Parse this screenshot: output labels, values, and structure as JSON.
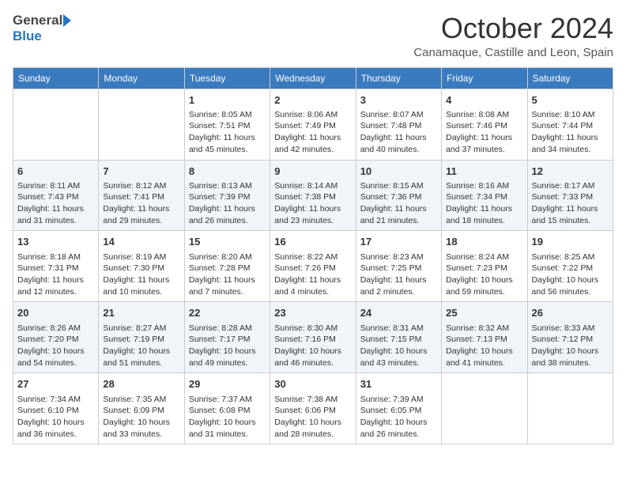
{
  "logo": {
    "line1": "General",
    "line2": "Blue"
  },
  "header": {
    "month": "October 2024",
    "location": "Canamaque, Castille and Leon, Spain"
  },
  "days_of_week": [
    "Sunday",
    "Monday",
    "Tuesday",
    "Wednesday",
    "Thursday",
    "Friday",
    "Saturday"
  ],
  "weeks": [
    [
      {
        "day": "",
        "data": ""
      },
      {
        "day": "",
        "data": ""
      },
      {
        "day": "1",
        "data": "Sunrise: 8:05 AM\nSunset: 7:51 PM\nDaylight: 11 hours and 45 minutes."
      },
      {
        "day": "2",
        "data": "Sunrise: 8:06 AM\nSunset: 7:49 PM\nDaylight: 11 hours and 42 minutes."
      },
      {
        "day": "3",
        "data": "Sunrise: 8:07 AM\nSunset: 7:48 PM\nDaylight: 11 hours and 40 minutes."
      },
      {
        "day": "4",
        "data": "Sunrise: 8:08 AM\nSunset: 7:46 PM\nDaylight: 11 hours and 37 minutes."
      },
      {
        "day": "5",
        "data": "Sunrise: 8:10 AM\nSunset: 7:44 PM\nDaylight: 11 hours and 34 minutes."
      }
    ],
    [
      {
        "day": "6",
        "data": "Sunrise: 8:11 AM\nSunset: 7:43 PM\nDaylight: 11 hours and 31 minutes."
      },
      {
        "day": "7",
        "data": "Sunrise: 8:12 AM\nSunset: 7:41 PM\nDaylight: 11 hours and 29 minutes."
      },
      {
        "day": "8",
        "data": "Sunrise: 8:13 AM\nSunset: 7:39 PM\nDaylight: 11 hours and 26 minutes."
      },
      {
        "day": "9",
        "data": "Sunrise: 8:14 AM\nSunset: 7:38 PM\nDaylight: 11 hours and 23 minutes."
      },
      {
        "day": "10",
        "data": "Sunrise: 8:15 AM\nSunset: 7:36 PM\nDaylight: 11 hours and 21 minutes."
      },
      {
        "day": "11",
        "data": "Sunrise: 8:16 AM\nSunset: 7:34 PM\nDaylight: 11 hours and 18 minutes."
      },
      {
        "day": "12",
        "data": "Sunrise: 8:17 AM\nSunset: 7:33 PM\nDaylight: 11 hours and 15 minutes."
      }
    ],
    [
      {
        "day": "13",
        "data": "Sunrise: 8:18 AM\nSunset: 7:31 PM\nDaylight: 11 hours and 12 minutes."
      },
      {
        "day": "14",
        "data": "Sunrise: 8:19 AM\nSunset: 7:30 PM\nDaylight: 11 hours and 10 minutes."
      },
      {
        "day": "15",
        "data": "Sunrise: 8:20 AM\nSunset: 7:28 PM\nDaylight: 11 hours and 7 minutes."
      },
      {
        "day": "16",
        "data": "Sunrise: 8:22 AM\nSunset: 7:26 PM\nDaylight: 11 hours and 4 minutes."
      },
      {
        "day": "17",
        "data": "Sunrise: 8:23 AM\nSunset: 7:25 PM\nDaylight: 11 hours and 2 minutes."
      },
      {
        "day": "18",
        "data": "Sunrise: 8:24 AM\nSunset: 7:23 PM\nDaylight: 10 hours and 59 minutes."
      },
      {
        "day": "19",
        "data": "Sunrise: 8:25 AM\nSunset: 7:22 PM\nDaylight: 10 hours and 56 minutes."
      }
    ],
    [
      {
        "day": "20",
        "data": "Sunrise: 8:26 AM\nSunset: 7:20 PM\nDaylight: 10 hours and 54 minutes."
      },
      {
        "day": "21",
        "data": "Sunrise: 8:27 AM\nSunset: 7:19 PM\nDaylight: 10 hours and 51 minutes."
      },
      {
        "day": "22",
        "data": "Sunrise: 8:28 AM\nSunset: 7:17 PM\nDaylight: 10 hours and 49 minutes."
      },
      {
        "day": "23",
        "data": "Sunrise: 8:30 AM\nSunset: 7:16 PM\nDaylight: 10 hours and 46 minutes."
      },
      {
        "day": "24",
        "data": "Sunrise: 8:31 AM\nSunset: 7:15 PM\nDaylight: 10 hours and 43 minutes."
      },
      {
        "day": "25",
        "data": "Sunrise: 8:32 AM\nSunset: 7:13 PM\nDaylight: 10 hours and 41 minutes."
      },
      {
        "day": "26",
        "data": "Sunrise: 8:33 AM\nSunset: 7:12 PM\nDaylight: 10 hours and 38 minutes."
      }
    ],
    [
      {
        "day": "27",
        "data": "Sunrise: 7:34 AM\nSunset: 6:10 PM\nDaylight: 10 hours and 36 minutes."
      },
      {
        "day": "28",
        "data": "Sunrise: 7:35 AM\nSunset: 6:09 PM\nDaylight: 10 hours and 33 minutes."
      },
      {
        "day": "29",
        "data": "Sunrise: 7:37 AM\nSunset: 6:08 PM\nDaylight: 10 hours and 31 minutes."
      },
      {
        "day": "30",
        "data": "Sunrise: 7:38 AM\nSunset: 6:06 PM\nDaylight: 10 hours and 28 minutes."
      },
      {
        "day": "31",
        "data": "Sunrise: 7:39 AM\nSunset: 6:05 PM\nDaylight: 10 hours and 26 minutes."
      },
      {
        "day": "",
        "data": ""
      },
      {
        "day": "",
        "data": ""
      }
    ]
  ]
}
